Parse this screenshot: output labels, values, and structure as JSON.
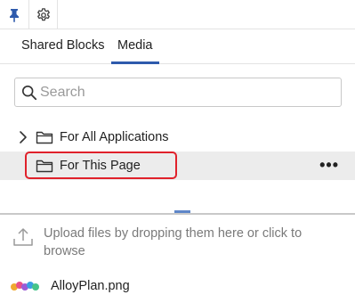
{
  "toolbar": {
    "pin_icon": "pin-icon",
    "settings_icon": "gear-icon",
    "accent_color": "#2e5aac"
  },
  "tabs": [
    {
      "label": "Shared Blocks",
      "active": false
    },
    {
      "label": "Media",
      "active": true
    }
  ],
  "search": {
    "placeholder": "Search",
    "value": ""
  },
  "folders": [
    {
      "label": "For All Applications",
      "expanded": false,
      "selected": false
    },
    {
      "label": "For This Page",
      "selected": true,
      "more_label": "•••"
    }
  ],
  "upload": {
    "text": "Upload files by dropping them here or click to browse"
  },
  "files": [
    {
      "name": "AlloyPlan.png"
    }
  ],
  "highlight_color": "#e0212b"
}
